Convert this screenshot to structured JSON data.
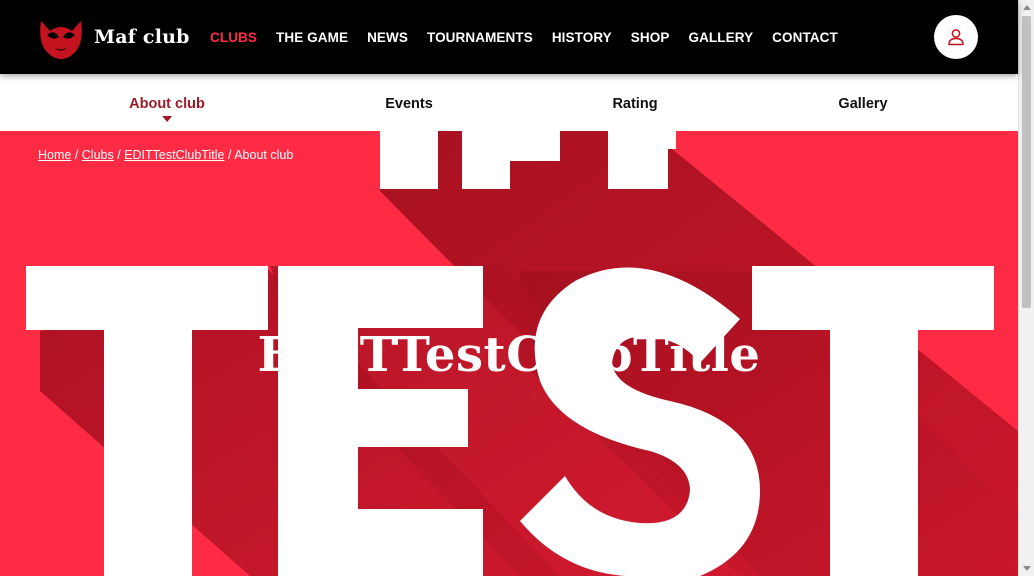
{
  "brand": {
    "name": "Maf club",
    "logo_icon": "mask-logo-icon",
    "accent": "#ff2b45",
    "dark_red": "#9c1b25"
  },
  "nav": {
    "items": [
      {
        "label": "CLUBS",
        "active": true
      },
      {
        "label": "THE GAME"
      },
      {
        "label": "NEWS"
      },
      {
        "label": "TOURNAMENTS"
      },
      {
        "label": "HISTORY"
      },
      {
        "label": "SHOP"
      },
      {
        "label": "GALLERY"
      },
      {
        "label": "CONTACT"
      }
    ],
    "user_icon": "user-icon"
  },
  "subnav": {
    "tabs": [
      {
        "label": "About club",
        "active": true
      },
      {
        "label": "Events"
      },
      {
        "label": "Rating"
      },
      {
        "label": "Gallery"
      }
    ]
  },
  "breadcrumb": {
    "items": [
      "Home",
      "Clubs",
      "EDITTestClubTitle"
    ],
    "separator": "/",
    "current": "About club"
  },
  "hero": {
    "title": "EDITTestClubTitle",
    "background_art_text": [
      "THE",
      "TEST"
    ],
    "background_color": "#ff2b45"
  }
}
